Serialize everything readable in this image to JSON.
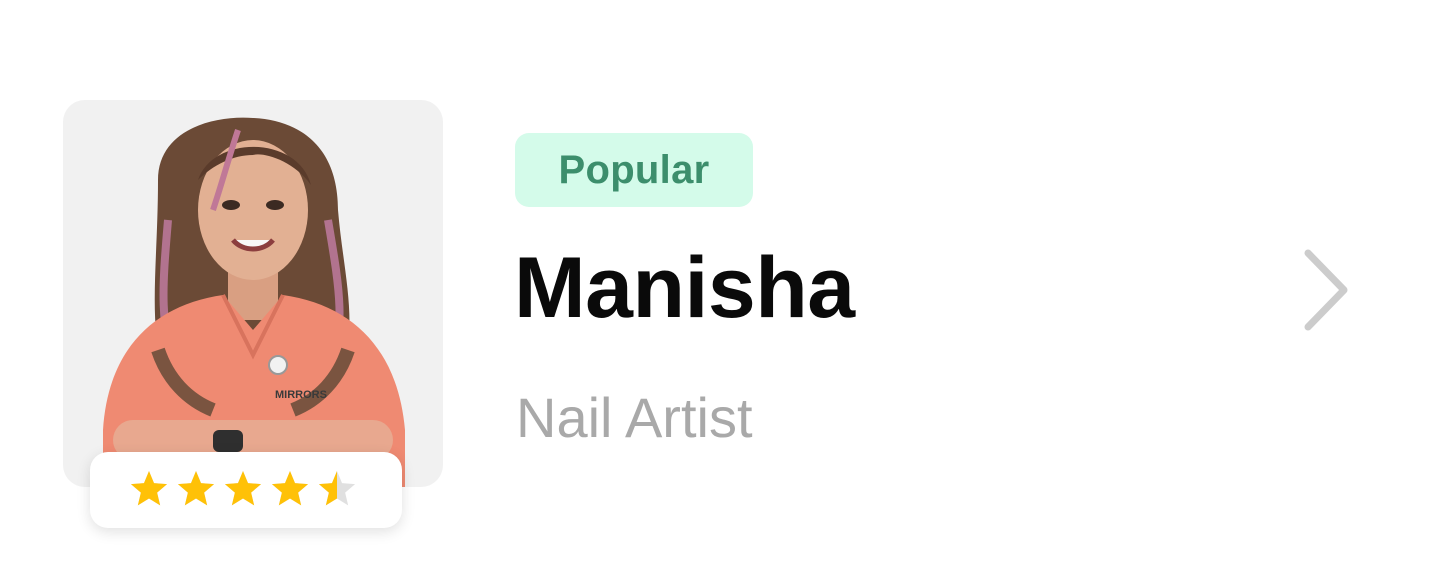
{
  "card": {
    "badge_label": "Popular",
    "name": "Manisha",
    "role": "Nail Artist",
    "rating": {
      "value": 4.5,
      "max": 5
    },
    "photo_icon": "person-photo",
    "chevron_icon": "chevron-right-icon",
    "colors": {
      "badge_bg": "#d4fbea",
      "badge_text": "#3c8e6c",
      "star": "#ffc107",
      "star_empty": "#e0e0e0",
      "name": "#0a0a0a",
      "role": "#a9a9a9",
      "chevron": "#cccccc"
    }
  }
}
